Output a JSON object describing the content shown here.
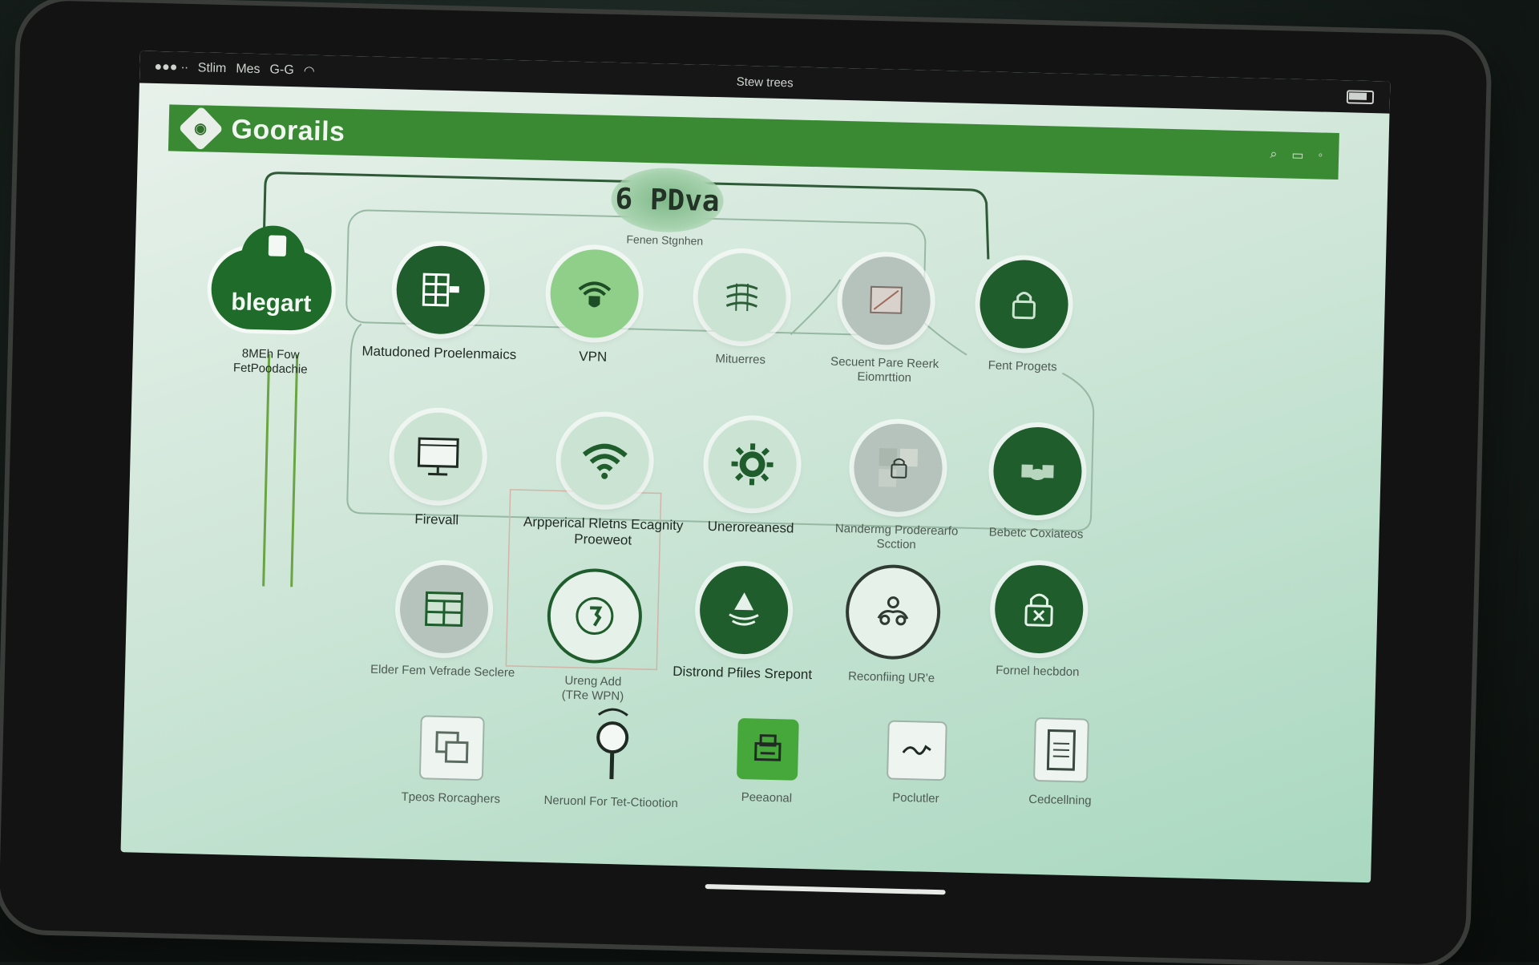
{
  "statusbar": {
    "left_items": [
      "Stlim",
      "Mes",
      "G-G"
    ],
    "center": "Stew trees"
  },
  "app": {
    "title": "Goorails"
  },
  "diagram": {
    "center_title": "6 PDva",
    "center_subtitle": "Fenen Stgnhen",
    "cloud": {
      "title": "blegart",
      "subtitle": "8MEh Fow\nFetPoodachie"
    },
    "row1": [
      {
        "label": "Matudoned Proelenmaics",
        "icon": "firewall-brick-icon"
      },
      {
        "label": "VPN",
        "icon": "shield-wifi-icon"
      },
      {
        "label": "Mituerres",
        "icon": "network-lines-icon"
      },
      {
        "label": "Secuent Pare Reerk Eiomrttion",
        "icon": "image-panel-icon"
      },
      {
        "label": "Fent Progets",
        "icon": "lock-icon"
      }
    ],
    "row2": [
      {
        "label": "Firevall",
        "icon": "monitor-icon"
      },
      {
        "label": "Arpperical Rletns Ecagnity Proeweot",
        "icon": "wifi-icon"
      },
      {
        "label": "Uneroreanesd",
        "icon": "gear-icon"
      },
      {
        "label": "Nandermg Proderearfo Scction",
        "icon": "lock-collage-icon"
      },
      {
        "label": "Bebetc Coxiateos",
        "icon": "handshake-icon"
      }
    ],
    "row3": [
      {
        "label": "Elder Fem Vefrade Seclere",
        "icon": "window-grid-icon"
      },
      {
        "label": "Ureng Add\n(TRe WPN)",
        "icon": "hand-icon"
      },
      {
        "label": "Distrond Pfiles Srepont",
        "icon": "bell-icon"
      },
      {
        "label": "Reconfiing UR'e",
        "icon": "people-icon"
      },
      {
        "label": "Fornel hecbdon",
        "icon": "lock-x-icon"
      }
    ],
    "row4": [
      {
        "label": "Tpeos Rorcaghers",
        "icon": "windows-icon"
      },
      {
        "label": "Neruonl For Tet-Ctiootion",
        "icon": "magnifier-icon"
      },
      {
        "label": "Peeaonal",
        "icon": "printer-icon"
      },
      {
        "label": "Poclutler",
        "icon": "signature-icon"
      },
      {
        "label": "Cedcellning",
        "icon": "document-icon"
      }
    ]
  },
  "colors": {
    "brand_green": "#3a8a33",
    "dark_green": "#1f5d2c",
    "screen_bg": "#cfe6d8"
  }
}
